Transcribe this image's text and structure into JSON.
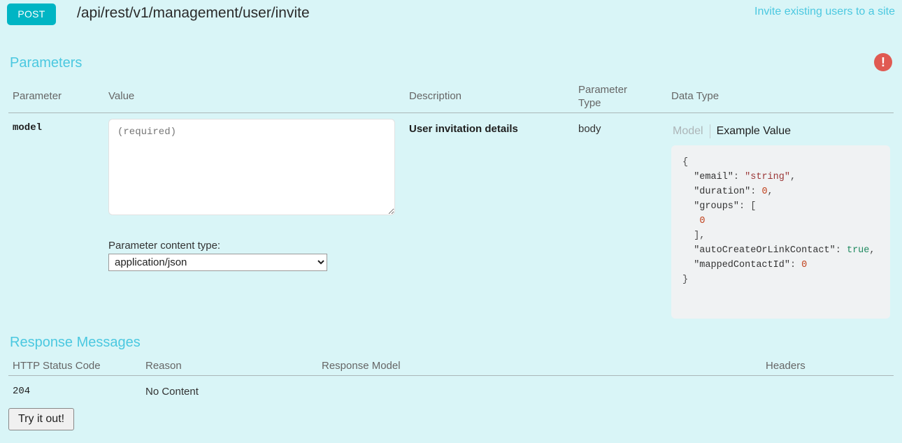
{
  "operation": {
    "method": "POST",
    "path": "/api/rest/v1/management/user/invite",
    "summary": "Invite existing users to a site"
  },
  "parameters_section": {
    "title": "Parameters",
    "error_icon": "exclamation-circle-icon",
    "columns": {
      "parameter": "Parameter",
      "value": "Value",
      "description": "Description",
      "parameter_type": "Parameter Type",
      "data_type": "Data Type"
    },
    "row": {
      "name": "model",
      "value_placeholder": "(required)",
      "value": "",
      "description": "User invitation details",
      "parameter_type": "body"
    },
    "content_type": {
      "label": "Parameter content type:",
      "selected": "application/json",
      "options": [
        "application/json"
      ]
    },
    "data_type": {
      "tabs": [
        {
          "label": "Model",
          "active": false
        },
        {
          "label": "Example Value",
          "active": true
        }
      ],
      "example_value": "{\n  \"email\": \"string\",\n  \"duration\": 0,\n  \"groups\": [\n    0\n  ],\n  \"autoCreateOrLinkContact\": true,\n  \"mappedContactId\": 0\n}",
      "example_fields": [
        {
          "key": "email",
          "value": "string",
          "kind": "string"
        },
        {
          "key": "duration",
          "value": "0",
          "kind": "number"
        },
        {
          "key": "groups",
          "value": "[0]",
          "kind": "array"
        },
        {
          "key": "autoCreateOrLinkContact",
          "value": "true",
          "kind": "boolean"
        },
        {
          "key": "mappedContactId",
          "value": "0",
          "kind": "number"
        }
      ]
    }
  },
  "response_section": {
    "title": "Response Messages",
    "columns": {
      "status_code": "HTTP Status Code",
      "reason": "Reason",
      "response_model": "Response Model",
      "headers": "Headers"
    },
    "rows": [
      {
        "status_code": "204",
        "reason": "No Content",
        "response_model": "",
        "headers": ""
      }
    ]
  },
  "actions": {
    "try_it_out": "Try it out!"
  },
  "colors": {
    "page_background": "#d9f5f7",
    "method_post": "#00b5c4",
    "accent_heading": "#4bc8e0",
    "error_red": "#e05a52",
    "example_box": "#f0f2f3"
  }
}
